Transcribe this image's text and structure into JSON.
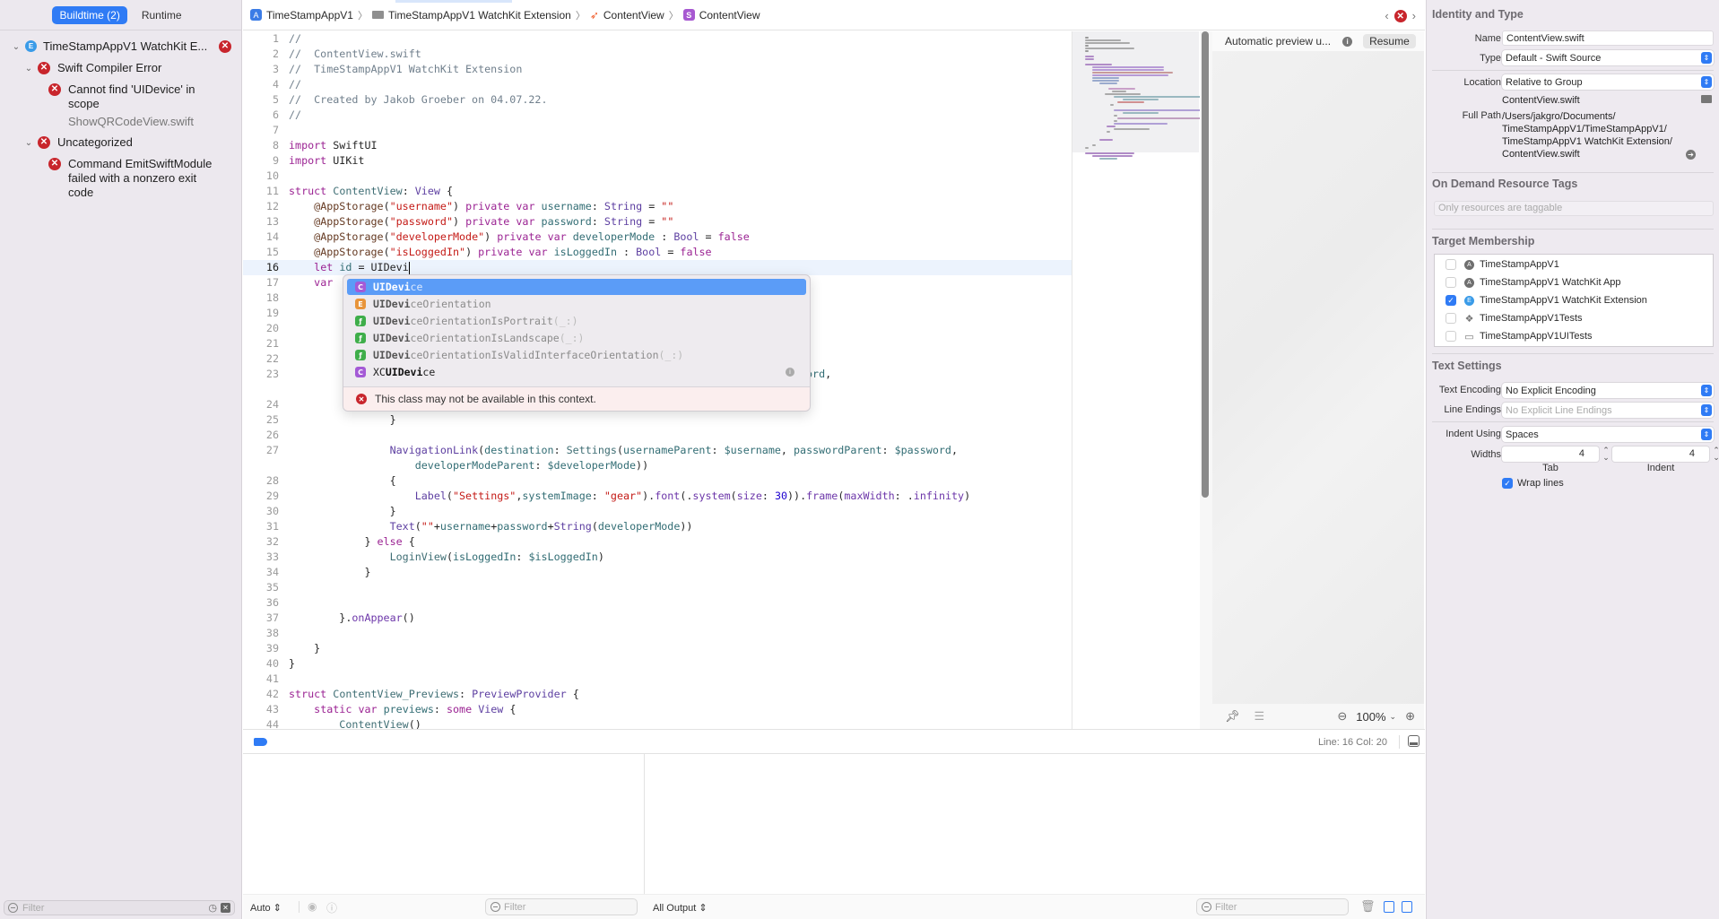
{
  "navigator": {
    "tabs": [
      {
        "label": "Buildtime (2)",
        "active": true
      },
      {
        "label": "Runtime",
        "active": false
      }
    ],
    "issues": {
      "target": {
        "label": "TimeStampAppV1 WatchKit E...",
        "icon": "extension-icon",
        "badge": "error"
      },
      "groups": [
        {
          "label": "Swift Compiler Error",
          "items": [
            {
              "line1": "Cannot find 'UIDevice' in",
              "line2": "scope",
              "file": "ShowQRCodeView.swift"
            }
          ]
        },
        {
          "label": "Uncategorized",
          "items": [
            {
              "line1": "Command EmitSwiftModule",
              "line2": "failed with a nonzero exit",
              "line3": "code"
            }
          ]
        }
      ]
    },
    "filter_placeholder": "Filter"
  },
  "jumpbar": {
    "crumbs": [
      {
        "label": "TimeStampAppV1",
        "icon": "app-project-icon"
      },
      {
        "label": "TimeStampAppV1 WatchKit Extension",
        "icon": "folder-icon"
      },
      {
        "label": "ContentView",
        "icon": "swift-file-icon"
      },
      {
        "label": "ContentView",
        "icon": "struct-icon",
        "glyph": "S"
      }
    ]
  },
  "editor": {
    "current_line": 16,
    "lines": [
      {
        "n": "1",
        "html": "<span class='cm'>//</span>"
      },
      {
        "n": "2",
        "html": "<span class='cm'>//  ContentView.swift</span>"
      },
      {
        "n": "3",
        "html": "<span class='cm'>//  TimeStampAppV1 WatchKit Extension</span>"
      },
      {
        "n": "4",
        "html": "<span class='cm'>//</span>"
      },
      {
        "n": "5",
        "html": "<span class='cm'>//  Created by Jakob Groeber on 04.07.22.</span>"
      },
      {
        "n": "6",
        "html": "<span class='cm'>//</span>"
      },
      {
        "n": "7",
        "html": ""
      },
      {
        "n": "8",
        "html": "<span class='kw'>import</span> SwiftUI"
      },
      {
        "n": "9",
        "html": "<span class='kw'>import</span> UIKit"
      },
      {
        "n": "10",
        "html": ""
      },
      {
        "n": "11",
        "html": "<span class='kw'>struct</span> <span class='typ'>ContentView</span>: <span class='kw' style='color:#5d3fa1'>View</span> {"
      },
      {
        "n": "12",
        "html": "    <span class='attr'>@AppStorage</span>(<span class='str'>\"username\"</span>) <span class='kw'>private</span> <span class='kw'>var</span> <span class='prop'>username</span>: <span style='color:#5d3fa1'>String</span> = <span class='str'>\"\"</span>"
      },
      {
        "n": "13",
        "html": "    <span class='attr'>@AppStorage</span>(<span class='str'>\"password\"</span>) <span class='kw'>private</span> <span class='kw'>var</span> <span class='prop'>password</span>: <span style='color:#5d3fa1'>String</span> = <span class='str'>\"\"</span>"
      },
      {
        "n": "14",
        "html": "    <span class='attr'>@AppStorage</span>(<span class='str'>\"developerMode\"</span>) <span class='kw'>private</span> <span class='kw'>var</span> <span class='prop'>developerMode</span> : <span style='color:#5d3fa1'>Bool</span> = <span class='kw'>false</span>"
      },
      {
        "n": "15",
        "html": "    <span class='attr'>@AppStorage</span>(<span class='str'>\"isLoggedIn\"</span>) <span class='kw'>private</span> <span class='kw'>var</span> <span class='prop'>isLoggedIn</span> : <span style='color:#5d3fa1'>Bool</span> = <span class='kw'>false</span>"
      },
      {
        "n": "16",
        "html": "    <span class='kw'>let</span> <span class='prop'>id</span> = UIDevi<span class='cursor'></span>"
      },
      {
        "n": "17",
        "html": "    <span class='kw'>var</span>"
      },
      {
        "n": "18",
        "html": ""
      },
      {
        "n": "19",
        "html": ""
      },
      {
        "n": "20",
        "html": ""
      },
      {
        "n": "21",
        "html": ""
      },
      {
        "n": "22",
        "html": ""
      },
      {
        "n": "23",
        "html": "                                                  <span class='prop'>username</span>, <span class='prop'>passwordParent</span>: <span class='prop'>$password</span>,"
      },
      {
        "n": "",
        "html": ""
      },
      {
        "n": "24",
        "html": ""
      },
      {
        "n": "25",
        "html": "                }"
      },
      {
        "n": "26",
        "html": ""
      },
      {
        "n": "27",
        "html": "                <span style='color:#5d3fa1'>NavigationLink</span>(<span class='prop'>destination</span>: <span class='typ'>Settings</span>(<span class='prop'>usernameParent</span>: <span class='prop'>$username</span>, <span class='prop'>passwordParent</span>: <span class='prop'>$password</span>,"
      },
      {
        "n": "",
        "html": "                    <span class='prop'>developerModeParent</span>: <span class='prop'>$developerMode</span>))"
      },
      {
        "n": "28",
        "html": "                {"
      },
      {
        "n": "29",
        "html": "                    <span style='color:#5d3fa1'>Label</span>(<span class='str'>\"Settings\"</span>,<span class='prop'>systemImage</span>: <span class='str'>\"gear\"</span>).<span class='fn' style='color:#6c36a9'>font</span>(.<span style='color:#6c36a9'>system</span>(<span style='color:#6c36a9'>size</span>: <span class='num'>30</span>)).<span style='color:#6c36a9'>frame</span>(<span style='color:#6c36a9'>maxWidth</span>: .<span style='color:#6c36a9'>infinity</span>)"
      },
      {
        "n": "30",
        "html": "                }"
      },
      {
        "n": "31",
        "html": "                <span style='color:#5d3fa1'>Text</span>(<span class='str'>\"\"</span>+<span class='prop'>username</span>+<span class='prop'>password</span>+<span style='color:#5d3fa1'>String</span>(<span class='prop'>developerMode</span>))"
      },
      {
        "n": "32",
        "html": "            } <span class='kw'>else</span> {"
      },
      {
        "n": "33",
        "html": "                <span class='typ'>LoginView</span>(<span class='prop'>isLoggedIn</span>: <span class='prop'>$isLoggedIn</span>)"
      },
      {
        "n": "34",
        "html": "            }"
      },
      {
        "n": "35",
        "html": ""
      },
      {
        "n": "36",
        "html": ""
      },
      {
        "n": "37",
        "html": "        }.<span style='color:#6c36a9'>onAppear</span>()"
      },
      {
        "n": "38",
        "html": ""
      },
      {
        "n": "39",
        "html": "    }"
      },
      {
        "n": "40",
        "html": "}"
      },
      {
        "n": "41",
        "html": ""
      },
      {
        "n": "42",
        "html": "<span class='kw'>struct</span> <span class='typ'>ContentView_Previews</span>: <span style='color:#5d3fa1'>PreviewProvider</span> {"
      },
      {
        "n": "43",
        "html": "    <span class='kw'>static</span> <span class='kw'>var</span> <span class='prop'>previews</span>: <span class='kw'>some</span> <span style='color:#5d3fa1'>View</span> {"
      },
      {
        "n": "44",
        "html": "        <span class='typ'>ContentView</span>()"
      }
    ]
  },
  "completion": {
    "items": [
      {
        "kind": "C",
        "color": "#a45ad6",
        "typed": "UIDevi",
        "rest": "ce",
        "prefix": "",
        "args": "",
        "selected": true
      },
      {
        "kind": "E",
        "color": "#e8943a",
        "typed": "UIDevi",
        "rest": "ceOrientation",
        "prefix": "",
        "args": "",
        "selected": false
      },
      {
        "kind": "f",
        "color": "#3fae4a",
        "typed": "UIDevi",
        "rest": "ceOrientationIsPortrait",
        "prefix": "",
        "args": "(_:)",
        "selected": false
      },
      {
        "kind": "f",
        "color": "#3fae4a",
        "typed": "UIDevi",
        "rest": "ceOrientationIsLandscape",
        "prefix": "",
        "args": "(_:)",
        "selected": false
      },
      {
        "kind": "f",
        "color": "#3fae4a",
        "typed": "UIDevi",
        "rest": "ceOrientationIsValidInterfaceOrientation",
        "prefix": "",
        "args": "(_:)",
        "selected": false
      },
      {
        "kind": "C",
        "color": "#a45ad6",
        "typed": "UIDevi",
        "rest": "ce",
        "prefix": "XC",
        "args": "",
        "selected": false,
        "info": true
      }
    ],
    "warning": "This class may not be available in this context."
  },
  "preview": {
    "status": "Automatic preview u...",
    "resume_label": "Resume",
    "zoom": "100%"
  },
  "status": {
    "line_col": "Line: 16  Col: 20"
  },
  "debug": {
    "auto_label": "Auto ⇕",
    "vars_filter_placeholder": "Filter",
    "output_label": "All Output ⇕",
    "console_filter_placeholder": "Filter"
  },
  "inspector": {
    "identity_title": "Identity and Type",
    "name_label": "Name",
    "name_value": "ContentView.swift",
    "type_label": "Type",
    "type_value": "Default - Swift Source",
    "location_label": "Location",
    "location_value": "Relative to Group",
    "location_file": "ContentView.swift",
    "fullpath_label": "Full Path",
    "fullpath_lines": [
      "/Users/jakgro/Documents/",
      "TimeStampAppV1/TimeStampAppV1/",
      "TimeStampAppV1 WatchKit Extension/",
      "ContentView.swift"
    ],
    "odr_title": "On Demand Resource Tags",
    "odr_placeholder": "Only resources are taggable",
    "target_title": "Target Membership",
    "targets": [
      {
        "label": "TimeStampAppV1",
        "checked": false,
        "icon": "app-target-icon"
      },
      {
        "label": "TimeStampAppV1 WatchKit App",
        "checked": false,
        "icon": "app-target-icon"
      },
      {
        "label": "TimeStampAppV1 WatchKit Extension",
        "checked": true,
        "icon": "extension-target-icon"
      },
      {
        "label": "TimeStampAppV1Tests",
        "checked": false,
        "icon": "unit-test-icon"
      },
      {
        "label": "TimeStampAppV1UITests",
        "checked": false,
        "icon": "ui-test-icon"
      }
    ],
    "text_title": "Text Settings",
    "encoding_label": "Text Encoding",
    "encoding_value": "No Explicit Encoding",
    "endings_label": "Line Endings",
    "endings_value": "No Explicit Line Endings",
    "indent_label": "Indent Using",
    "indent_value": "Spaces",
    "widths_label": "Widths",
    "tab_width": "4",
    "indent_width": "4",
    "tab_label": "Tab",
    "indent_sub_label": "Indent",
    "wrap_label": "Wrap lines",
    "wrap_checked": true
  }
}
